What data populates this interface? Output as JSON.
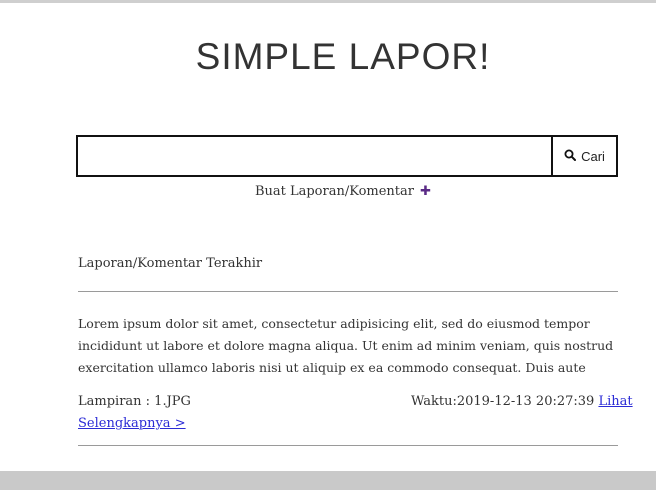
{
  "header": {
    "title": "SIMPLE LAPOR!"
  },
  "search": {
    "placeholder": "",
    "value": "",
    "button_label": "Cari"
  },
  "create_link": {
    "label": "Buat Laporan/Komentar",
    "icon": "plus-icon",
    "color": "#5a2a86"
  },
  "latest": {
    "section_title": "Laporan/Komentar Terakhir",
    "report": {
      "body": "Lorem ipsum dolor sit amet, consectetur adipisicing elit, sed do eiusmod tempor incididunt ut labore et dolore magna aliqua. Ut enim ad minim veniam, quis nostrud exercitation ullamco laboris nisi ut aliquip ex ea commodo consequat. Duis aute",
      "attachment": "Lampiran : 1.JPG",
      "time_text": "Waktu:2019-12-13 20:27:39",
      "more_link_part1": "Lihat",
      "more_link_part2": "Selengkapnya >"
    }
  },
  "colors": {
    "link": "#2b2bd6",
    "accent": "#5a2a86"
  }
}
